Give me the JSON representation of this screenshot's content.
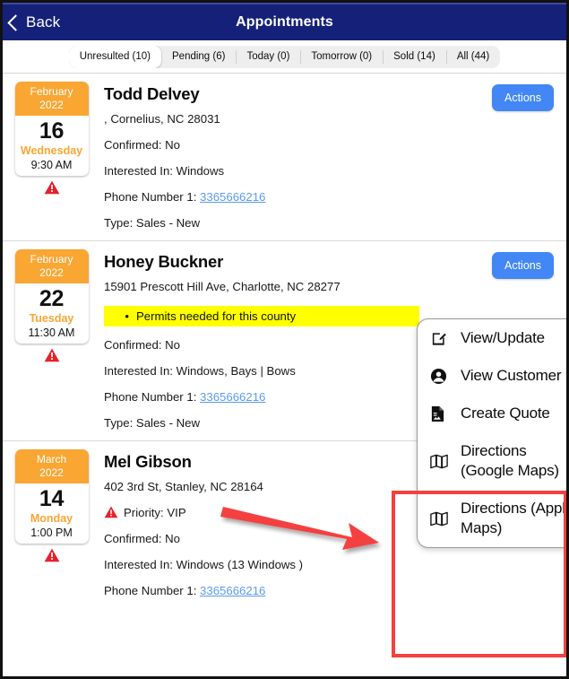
{
  "navbar": {
    "back_label": "Back",
    "title": "Appointments",
    "back_icon": "chevron-left-icon",
    "bg_color": "#152179"
  },
  "tabs": [
    {
      "label": "Unresulted (10)",
      "selected": true
    },
    {
      "label": "Pending (6)",
      "selected": false
    },
    {
      "label": "Today (0)",
      "selected": false
    },
    {
      "label": "Tomorrow (0)",
      "selected": false
    },
    {
      "label": "Sold (14)",
      "selected": false
    },
    {
      "label": "All (44)",
      "selected": false
    }
  ],
  "appointments": [
    {
      "date": {
        "month_year": "February\n2022",
        "month": "February",
        "year": "2022",
        "day": "16",
        "weekday": "Wednesday",
        "time": "9:30 AM"
      },
      "alert_icon": "warning-triangle-icon",
      "customer_name": "Todd Delvey",
      "address": ", Cornelius, NC 28031",
      "note": null,
      "priority": null,
      "confirmed": "Confirmed: No",
      "interested": "Interested In: Windows",
      "phone_label": "Phone Number 1:",
      "phone": "3365666216",
      "type": "Type: Sales - New",
      "actions_label": "Actions"
    },
    {
      "date": {
        "month": "February",
        "year": "2022",
        "day": "22",
        "weekday": "Tuesday",
        "time": "11:30 AM"
      },
      "alert_icon": "warning-triangle-icon",
      "customer_name": "Honey Buckner",
      "address": "15901 Prescott Hill Ave, Charlotte, NC 28277",
      "note": "Permits needed for this county",
      "priority": null,
      "confirmed": "Confirmed: No",
      "interested": "Interested In: Windows, Bays | Bows",
      "phone_label": "Phone Number 1:",
      "phone": "3365666216",
      "type": "Type: Sales - New",
      "actions_label": "Actions"
    },
    {
      "date": {
        "month": "March",
        "year": "2022",
        "day": "14",
        "weekday": "Monday",
        "time": "1:00 PM"
      },
      "alert_icon": "warning-triangle-icon",
      "customer_name": "Mel Gibson",
      "address": "402 3rd St, Stanley, NC 28164",
      "note": null,
      "priority": "Priority: VIP",
      "confirmed": "Confirmed: No",
      "interested": "Interested In: Windows (13 Windows )",
      "phone_label": "Phone Number 1:",
      "phone": "3365666216",
      "type": null,
      "actions_label": null
    }
  ],
  "popover_menu": {
    "items": [
      {
        "label": "View/Update",
        "icon": "pencil-square-icon",
        "highlighted": false
      },
      {
        "label": "View Customer",
        "icon": "person-circle-icon",
        "highlighted": false
      },
      {
        "label": "Create Quote",
        "icon": "document-icon",
        "highlighted": false
      },
      {
        "label": "Directions (Google Maps)",
        "icon": "map-icon",
        "highlighted": true
      },
      {
        "label": "Directions (Apple Maps)",
        "icon": "map-icon",
        "highlighted": true
      }
    ]
  },
  "annotations": {
    "highlight_box_color": "#f4413f",
    "arrow_color": "#f4413f"
  },
  "colors": {
    "accent_blue": "#4287f5",
    "date_orange": "#f9a633",
    "alert_red": "#e8202a",
    "note_highlight": "#ffff00",
    "link_blue": "#5b9bf0"
  }
}
